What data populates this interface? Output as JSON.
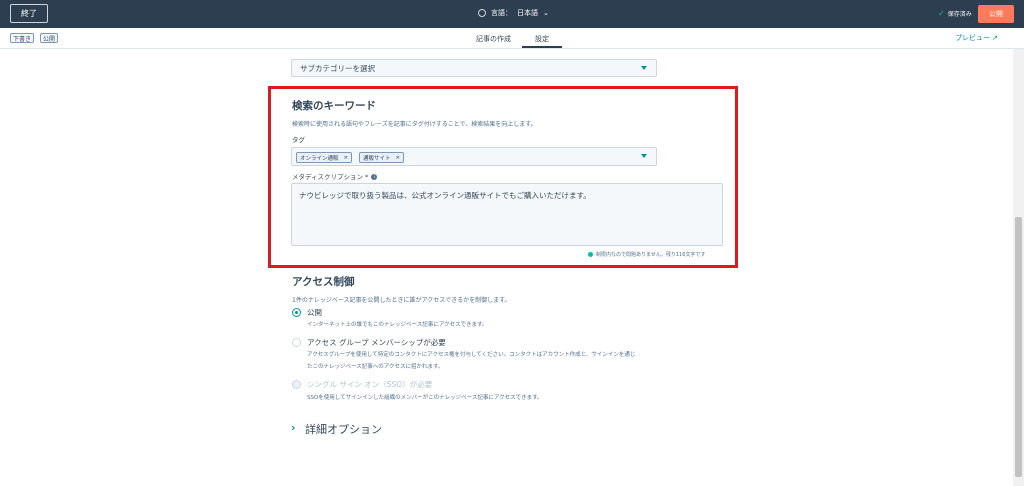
{
  "header": {
    "exit_label": "終了",
    "language_label": "言語：",
    "language_value": "日本語",
    "language_chevron": "⌄",
    "saved_label": "保存済み",
    "publish_label": "公開"
  },
  "subbar": {
    "draft_badge": "下書き",
    "public_badge": "公開",
    "tabs": [
      {
        "label": "記事の作成"
      },
      {
        "label": "設定"
      }
    ],
    "preview_label": "プレビュー",
    "preview_icon": "external-link-icon"
  },
  "subcategory": {
    "placeholder": "サブカテゴリーを選択"
  },
  "seo": {
    "title": "検索のキーワード",
    "description": "検索時に使用される語句やフレーズを記事にタグ付けすることで、検索結果を向上します。",
    "tags_label": "タグ",
    "tags": [
      {
        "label": "オンライン通販"
      },
      {
        "label": "通販サイト"
      }
    ],
    "meta_label": "メタディスクリプション *",
    "meta_value": "ナウビレッジで取り扱う製品は、公式オンライン通販サイトでもご購入いただけます。",
    "meta_status": "制限内なので問題ありません。残り116文字です"
  },
  "access": {
    "title": "アクセス制御",
    "description": "1件のナレッジベース記事を公開したときに誰がアクセスできるかを制御します。",
    "options": [
      {
        "title": "公開",
        "desc": "インターネット上の誰でもこのナレッジベース記事にアクセスできます。"
      },
      {
        "title": "アクセス グループ メンバーシップが必要",
        "desc": "アクセスグループを使用して特定のコンタクトにアクセス権を付与してください。コンタクトはアカウント作成と、サインインを通じ",
        "desc2": "たこのナレッジベース記事へのアクセスに招かれます。"
      },
      {
        "title": "シングル サイン オン（SSO）が必要",
        "desc": "SSOを使用してサインインした組織のメンバーがこのナレッジベース記事にアクセスできます。"
      }
    ]
  },
  "advanced": {
    "title": "詳細オプション"
  },
  "colors": {
    "topbar": "#2d3e50",
    "accent": "#0091ae",
    "publish": "#ff7a59",
    "highlight": "#e0181f"
  }
}
